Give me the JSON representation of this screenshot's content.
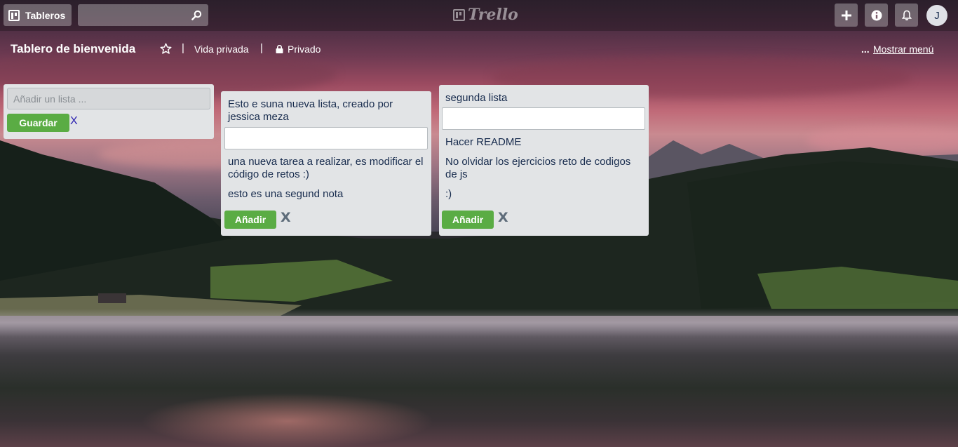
{
  "topbar": {
    "boards_label": "Tableros",
    "search_value": "",
    "logo_text": "Trello",
    "avatar_initial": "J"
  },
  "board": {
    "title": "Tablero de bienvenida",
    "visibility_team": "Vida privada",
    "visibility": "Privado",
    "menu_dots": "...",
    "menu_label": "Mostrar menú"
  },
  "add_list": {
    "placeholder": "Añadir un lista ...",
    "save_label": "Guardar",
    "cancel_label": "X"
  },
  "lists": [
    {
      "title": "Esto e suna nueva lista, creado por jessica meza",
      "cards": [
        "una nueva tarea a realizar, es modificar el código de retos :)",
        "esto es una segund nota"
      ],
      "add_label": "Añadir",
      "cancel_label": "X"
    },
    {
      "title": "segunda lista",
      "cards": [
        "Hacer README",
        "No olvidar los ejercicios reto de codigos de js",
        ":)"
      ],
      "add_label": "Añadir",
      "cancel_label": "X"
    }
  ],
  "colors": {
    "accent_green": "#5aac44",
    "list_bg": "#e2e4e6",
    "cancel_blue": "#2a1fb0"
  },
  "icons": [
    "boards-icon",
    "search-icon",
    "plus-icon",
    "info-icon",
    "bell-icon",
    "star-icon",
    "lock-icon"
  ]
}
